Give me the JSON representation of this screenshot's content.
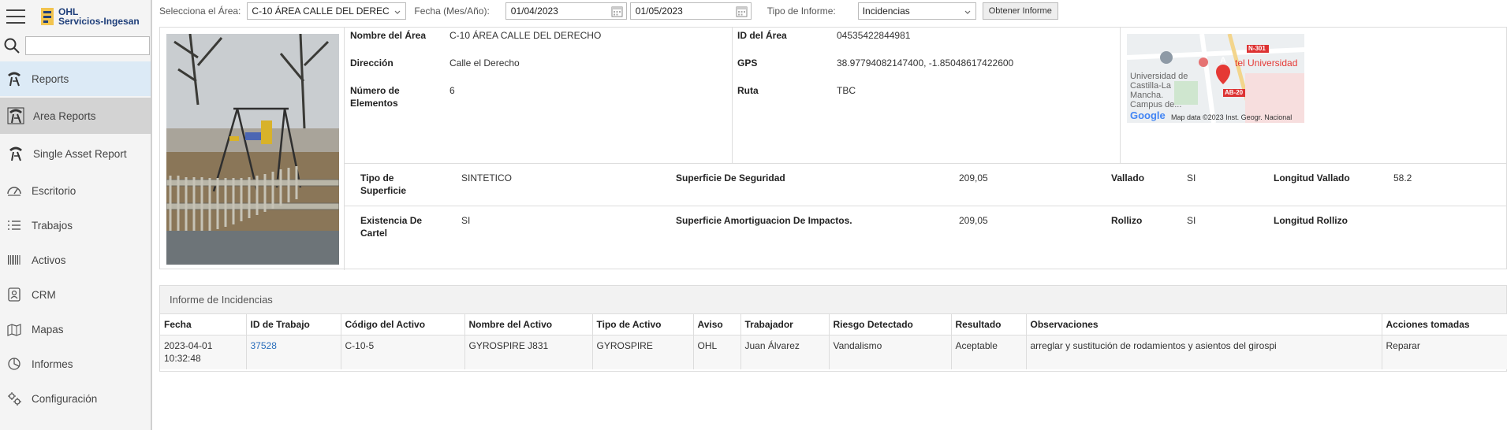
{
  "app": {
    "logo_line1": "OHL",
    "logo_line2": "Servicios-Ingesan",
    "search_placeholder": ""
  },
  "nav": [
    {
      "label": "Reports",
      "icon": "reports-icon"
    },
    {
      "label": "Area Reports",
      "icon": "area-reports-icon"
    },
    {
      "label": "Single Asset Report",
      "icon": "single-asset-icon"
    },
    {
      "label": "Escritorio",
      "icon": "dashboard-icon"
    },
    {
      "label": "Trabajos",
      "icon": "tasks-icon"
    },
    {
      "label": "Activos",
      "icon": "barcode-icon"
    },
    {
      "label": "CRM",
      "icon": "crm-icon"
    },
    {
      "label": "Mapas",
      "icon": "map-icon"
    },
    {
      "label": "Informes",
      "icon": "reports-chart-icon"
    },
    {
      "label": "Configuración",
      "icon": "settings-icon"
    }
  ],
  "filters": {
    "area_label": "Selecciona el Área:",
    "area_value": "C-10 ÁREA CALLE DEL DEREC",
    "date_label": "Fecha (Mes/Año):",
    "date_from": "01/04/2023",
    "date_to": "01/05/2023",
    "report_type_label": "Tipo de Informe:",
    "report_type_value": "Incidencias",
    "submit_label": "Obtener Informe"
  },
  "area": {
    "name_label": "Nombre del Área",
    "name_value": "C-10 ÁREA CALLE DEL DERECHO",
    "address_label": "Dirección",
    "address_value": "Calle el Derecho",
    "elements_label": "Número de Elementos",
    "elements_value": "6",
    "id_label": "ID del Área",
    "id_value": "04535422844981",
    "gps_label": "GPS",
    "gps_value": "38.97794082147400, -1.85048617422600",
    "route_label": "Ruta",
    "route_value": "TBC",
    "map_label": "tel Universidad",
    "map_road1": "N-301",
    "map_road2": "AB-20",
    "map_place": "Universidad de Castilla-La Mancha. Campus de...",
    "map_marker": "A",
    "map_logo": "Google",
    "map_attribution": "Map data ©2023 Inst. Geogr. Nacional"
  },
  "attributes": [
    {
      "k1": "Tipo de Superficie",
      "v1": "SINTETICO",
      "k2": "Superficie De Seguridad",
      "v2": "209,05",
      "k3": "Vallado",
      "v3": "SI",
      "k4": "Longitud Vallado",
      "v4": "58.2"
    },
    {
      "k1": "Existencia De Cartel",
      "v1": "SI",
      "k2": "Superficie Amortiguacion De Impactos.",
      "v2": "209,05",
      "k3": "Rollizo",
      "v3": "SI",
      "k4": "Longitud Rollizo",
      "v4": ""
    }
  ],
  "incidents": {
    "title": "Informe de Incidencias",
    "columns": [
      "Fecha",
      "ID de Trabajo",
      "Código del Activo",
      "Nombre del Activo",
      "Tipo de Activo",
      "Aviso",
      "Trabajador",
      "Riesgo Detectado",
      "Resultado",
      "Observaciones",
      "Acciones tomadas"
    ],
    "rows": [
      {
        "fecha": "2023-04-01 10:32:48",
        "id_trabajo": "37528",
        "codigo": "C-10-5",
        "nombre": "GYROSPIRE J831",
        "tipo": "GYROSPIRE",
        "aviso": "OHL",
        "trabajador": "Juan Álvarez",
        "riesgo": "Vandalismo",
        "resultado": "Aceptable",
        "observaciones": "arreglar y sustitución de rodamientos y asientos del girospi",
        "acciones": "Reparar"
      }
    ]
  }
}
